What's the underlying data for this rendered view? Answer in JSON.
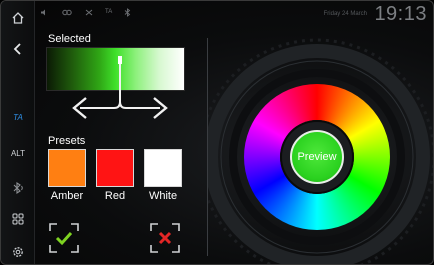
{
  "status_bar": {
    "icons": [
      "mute-icon",
      "signal-icon",
      "network-icon",
      "ta-icon",
      "bluetooth-icon"
    ],
    "ta_label": "TA",
    "date": "Friday 24 March",
    "time": "19:13"
  },
  "sidebar": {
    "ta_label": "TA",
    "alt_label": "ALT"
  },
  "selected": {
    "title": "Selected",
    "position": 0.5
  },
  "presets": {
    "title": "Presets",
    "items": [
      {
        "label": "Amber",
        "color": "#ff7f12"
      },
      {
        "label": "Red",
        "color": "#ff1414"
      },
      {
        "label": "White",
        "color": "#ffffff"
      }
    ]
  },
  "wheel": {
    "preview_label": "Preview",
    "preview_color": "#2ad11f"
  },
  "colors": {
    "accent_blue": "#2f8fe6",
    "confirm_green": "#7ed321",
    "cancel_red": "#e32626"
  }
}
